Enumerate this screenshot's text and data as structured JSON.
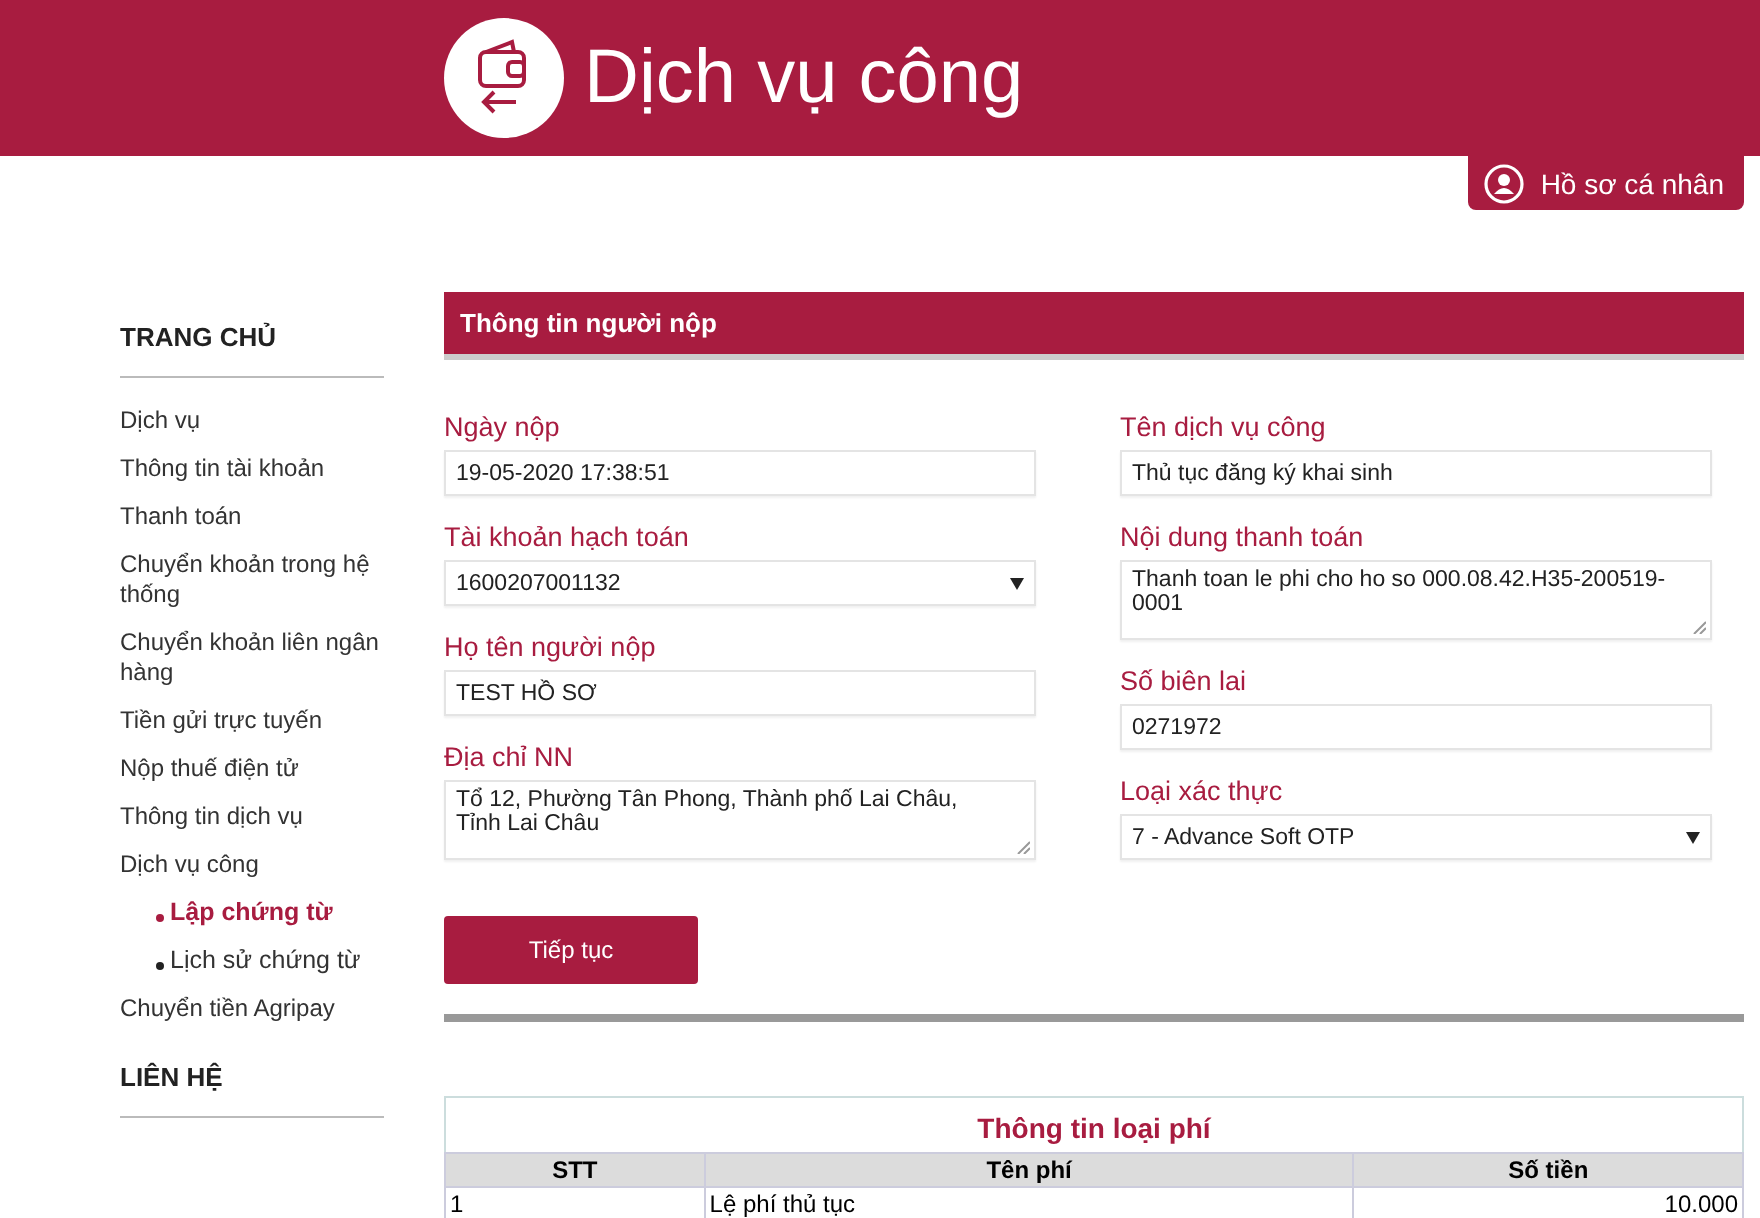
{
  "header": {
    "title": "Dịch vụ công",
    "profile_button": "Hồ sơ cá nhân"
  },
  "sidebar": {
    "sections": [
      {
        "title": "TRANG CHỦ",
        "items": [
          {
            "label": "Dịch vụ",
            "selected": false
          },
          {
            "label": "Thông tin tài khoản",
            "selected": false
          },
          {
            "label": "Thanh toán",
            "selected": false
          },
          {
            "label": "Chuyển khoản trong hệ thống",
            "selected": false
          },
          {
            "label": "Chuyển khoản liên ngân hàng",
            "selected": false
          },
          {
            "label": "Tiền gửi trực tuyến",
            "selected": false
          },
          {
            "label": "Nộp thuế điện tử",
            "selected": false
          },
          {
            "label": "Thông tin dịch vụ",
            "selected": false
          },
          {
            "label": "Dịch vụ công",
            "selected": false,
            "children": [
              {
                "label": "Lập chứng từ",
                "selected": true
              },
              {
                "label": "Lịch sử chứng từ",
                "selected": false
              }
            ]
          },
          {
            "label": "Chuyển tiền Agripay",
            "selected": false
          }
        ]
      },
      {
        "title": "LIÊN HỆ"
      }
    ]
  },
  "form": {
    "title": "Thông tin người nộp",
    "columns": [
      [
        {
          "label": "Ngày nộp",
          "kind": "text",
          "value": "19-05-2020 17:38:51"
        },
        {
          "label": "Tài khoản hạch toán",
          "kind": "select",
          "value": "1600207001132"
        },
        {
          "label": "Họ tên người nộp",
          "kind": "text",
          "value": "TEST HỒ SƠ"
        },
        {
          "label": "Địa chỉ NN",
          "kind": "textarea",
          "value": "Tổ 12, Phường Tân Phong, Thành phố Lai Châu, Tỉnh Lai Châu"
        }
      ],
      [
        {
          "label": "Tên dịch vụ công",
          "kind": "text",
          "value": "Thủ tục đăng ký khai sinh"
        },
        {
          "label": "Nội dung thanh toán",
          "kind": "textarea",
          "value": "Thanh toan le phi cho ho so 000.08.42.H35-200519-0001"
        },
        {
          "label": "Số biên lai",
          "kind": "text",
          "value": "0271972"
        },
        {
          "label": "Loại xác thực",
          "kind": "select",
          "value": "7 - Advance Soft OTP"
        }
      ]
    ],
    "submit_button": "Tiếp tục"
  },
  "fee_table": {
    "title": "Thông tin loại phí",
    "columns": [
      "STT",
      "Tên phí",
      "Số tiền"
    ],
    "rows": [
      [
        "1",
        "Lệ phí thủ tục",
        "10.000"
      ]
    ]
  }
}
